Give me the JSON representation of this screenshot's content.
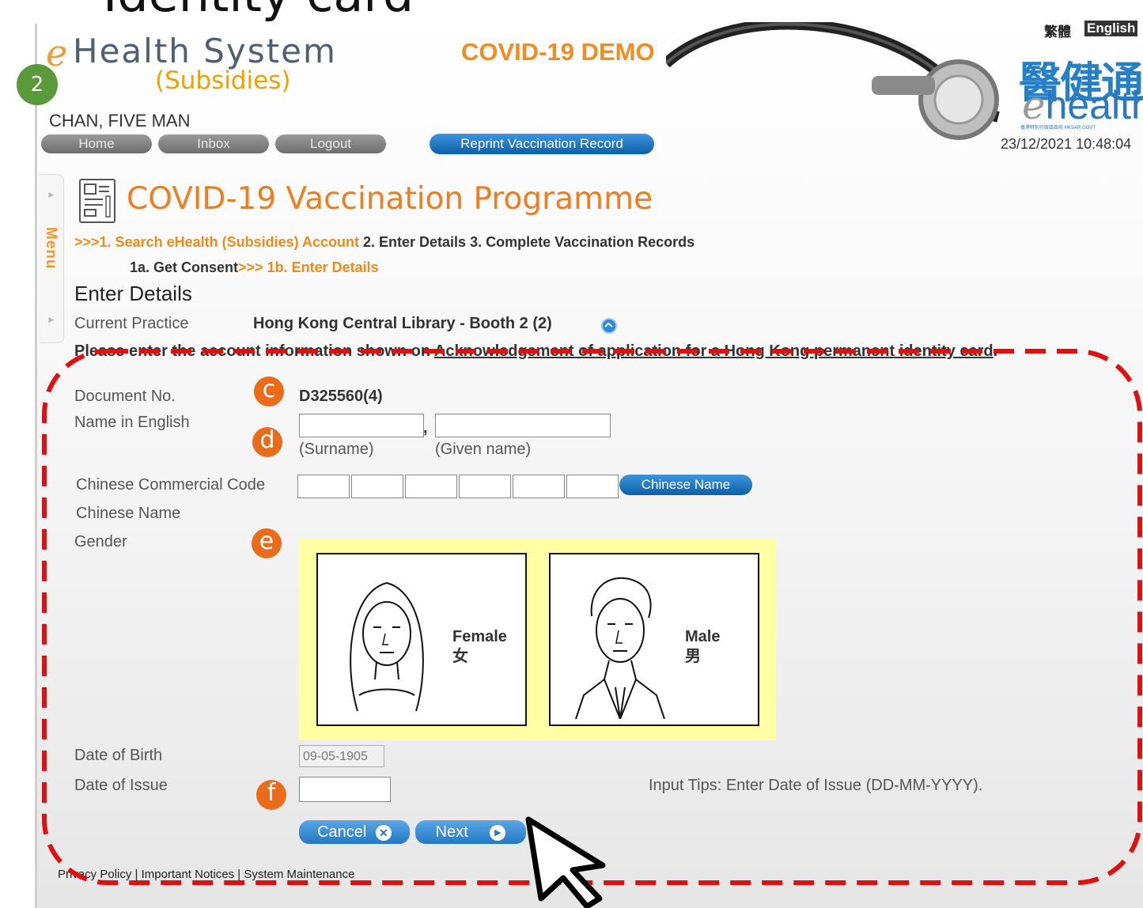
{
  "slide_title": "Identity card",
  "step_badge": "2",
  "app": {
    "logo_e": "e",
    "logo_name": "Health System",
    "demo_label": "COVID-19 DEMO",
    "subtitle": "(Subsidies)"
  },
  "user": {
    "name": "CHAN, FIVE MAN"
  },
  "nav": {
    "home": "Home",
    "inbox": "Inbox",
    "logout": "Logout",
    "reprint": "Reprint Vaccination Record"
  },
  "lang": {
    "zh": "繁體",
    "en": "English"
  },
  "brand": {
    "zh": "醫健通",
    "en_e": "e",
    "en": "health",
    "tiny": "香港特別行政區政府 HKSAR GOVT"
  },
  "datetime": "23/12/2021 10:48:04",
  "menu_label": "Menu",
  "page": {
    "title": "COVID-19  Vaccination Programme",
    "crumbs": {
      "arrows": ">>>",
      "s1": "1. Search eHealth (Subsidies) Account",
      "s2": "2. Enter Details",
      "s3": "3. Complete Vaccination Records",
      "s1a": "1a. Get Consent",
      "arrows2": ">>>",
      "s1b": "1b. Enter Details"
    },
    "section_heading": "Enter Details",
    "current_practice_label": "Current Practice",
    "current_practice_value": "Hong Kong Central Library - Booth 2 (2)",
    "instruction_prefix": "Please enter the account information shown on ",
    "instruction_link": "Acknowledgement of application for a Hong Kong permanent identity card",
    "instruction_suffix": "."
  },
  "form": {
    "document_no_label": "Document No.",
    "document_no_value": "D325560(4)",
    "name_en_label": "Name in English",
    "surname_value": "",
    "given_name_value": "",
    "name_separator": ",",
    "surname_hint": "(Surname)",
    "given_name_hint": "(Given name)",
    "ccc_label": "Chinese Commercial Code",
    "ccc_values": [
      "",
      "",
      "",
      "",
      "",
      ""
    ],
    "chinese_name_button": "Chinese Name",
    "chinese_name_label": "Chinese Name",
    "gender_label": "Gender",
    "female_en": "Female",
    "female_zh": "女",
    "male_en": "Male",
    "male_zh": "男",
    "dob_label": "Date of Birth",
    "dob_value": "09-05-1905",
    "doi_label": "Date of Issue",
    "doi_value": "",
    "tips": "Input Tips: Enter Date of Issue (DD-MM-YYYY).",
    "cancel": "Cancel",
    "next": "Next"
  },
  "callouts": {
    "c": "c",
    "d": "d",
    "e": "e",
    "f": "f"
  },
  "footer": {
    "privacy": "Privacy Policy",
    "sep1": " | ",
    "notices": "Important Notices",
    "sep2": " | ",
    "maintenance": "System Maintenance"
  },
  "colors": {
    "accent_orange": "#f08a1a",
    "button_blue": "#0c5fa8",
    "gender_bg": "#ffffa4",
    "dash_red": "#e01010",
    "badge_green": "#5a9a3a"
  }
}
